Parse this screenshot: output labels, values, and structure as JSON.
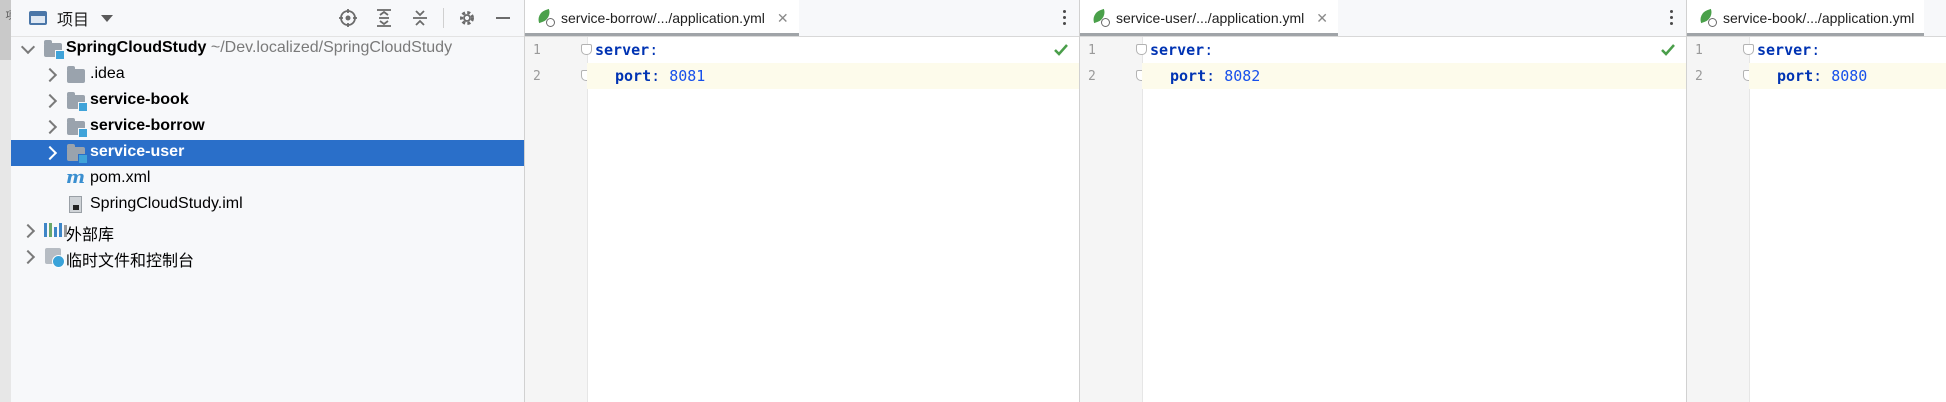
{
  "left_strip": {
    "label": "项"
  },
  "project_panel": {
    "title": "项目",
    "tree": [
      {
        "label": "SpringCloudStudy",
        "path": "~/Dev.localized/SpringCloudStudy"
      },
      {
        "label": ".idea"
      },
      {
        "label": "service-book"
      },
      {
        "label": "service-borrow"
      },
      {
        "label": "service-user"
      },
      {
        "label": "pom.xml"
      },
      {
        "label": "SpringCloudStudy.iml"
      },
      {
        "label": "外部库"
      },
      {
        "label": "临时文件和控制台"
      }
    ]
  },
  "editors": [
    {
      "tab": "service-borrow/.../application.yml",
      "lines": [
        {
          "num": "1",
          "key": "server"
        },
        {
          "num": "2",
          "key": "port",
          "value": "8081"
        }
      ]
    },
    {
      "tab": "service-user/.../application.yml",
      "lines": [
        {
          "num": "1",
          "key": "server"
        },
        {
          "num": "2",
          "key": "port",
          "value": "8082"
        }
      ]
    },
    {
      "tab": "service-book/.../application.yml",
      "lines": [
        {
          "num": "1",
          "key": "server"
        },
        {
          "num": "2",
          "key": "port",
          "value": "8080"
        }
      ]
    }
  ],
  "colors": {
    "selection": "#2a6fc9",
    "yaml_key": "#0033b3",
    "number": "#1750eb",
    "check": "#4a9e4a"
  }
}
